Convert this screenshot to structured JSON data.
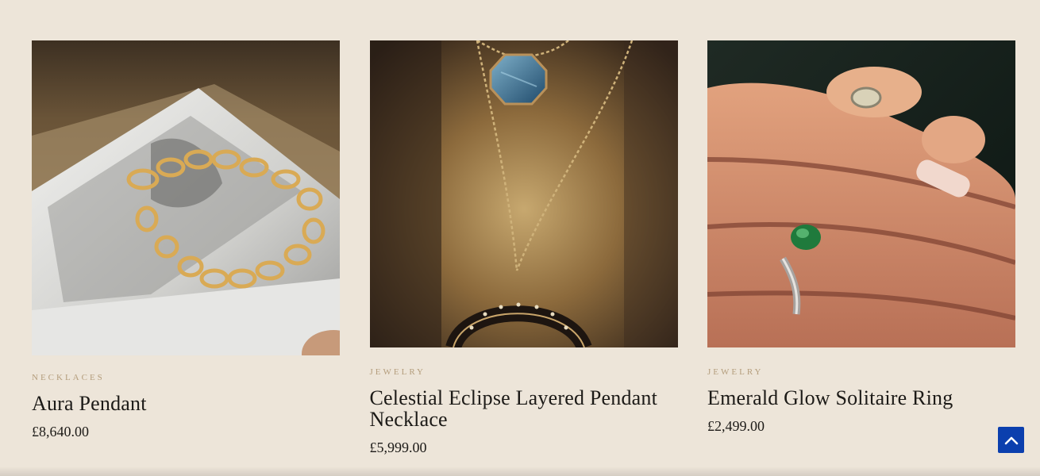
{
  "products": [
    {
      "category": "NECKLACES",
      "title": "Aura Pendant",
      "price": "£8,640.00",
      "image_icon": "gold-chain-bracelet-photo"
    },
    {
      "category": "JEWELRY",
      "title": "Celestial Eclipse Layered Pendant Necklace",
      "price": "£5,999.00",
      "image_icon": "layered-pendant-necklace-photo"
    },
    {
      "category": "JEWELRY",
      "title": "Emerald Glow Solitaire Ring",
      "price": "£2,499.00",
      "image_icon": "emerald-ring-hand-photo"
    }
  ],
  "scroll_top_icon": "chevron-up-icon",
  "colors": {
    "background": "#ede5d9",
    "category": "#b49d7c",
    "accent_button": "#0b3fae"
  }
}
